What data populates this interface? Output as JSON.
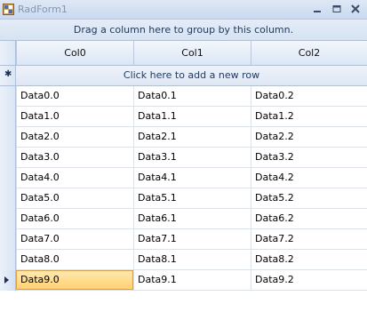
{
  "window": {
    "title": "RadForm1"
  },
  "grid": {
    "group_panel_text": "Drag a column here to group by this column.",
    "columns": [
      "Col0",
      "Col1",
      "Col2"
    ],
    "add_row_text": "Click here to add a new row",
    "rows": [
      [
        "Data0.0",
        "Data0.1",
        "Data0.2"
      ],
      [
        "Data1.0",
        "Data1.1",
        "Data1.2"
      ],
      [
        "Data2.0",
        "Data2.1",
        "Data2.2"
      ],
      [
        "Data3.0",
        "Data3.1",
        "Data3.2"
      ],
      [
        "Data4.0",
        "Data4.1",
        "Data4.2"
      ],
      [
        "Data5.0",
        "Data5.1",
        "Data5.2"
      ],
      [
        "Data6.0",
        "Data6.1",
        "Data6.2"
      ],
      [
        "Data7.0",
        "Data7.1",
        "Data7.2"
      ],
      [
        "Data8.0",
        "Data8.1",
        "Data8.2"
      ],
      [
        "Data9.0",
        "Data9.1",
        "Data9.2"
      ]
    ],
    "current_row": 9,
    "current_col": 0
  },
  "icons": {
    "app": "app-icon",
    "minimize": "minimize-icon",
    "maximize": "maximize-icon",
    "close": "close-icon",
    "new_row": "asterisk-icon",
    "current_row": "row-arrow-icon"
  },
  "colors": {
    "title_text": "#8796b0",
    "selection_fill": "#ffd173",
    "selection_border": "#f09a2b",
    "grid_line": "#d7e2ef"
  }
}
